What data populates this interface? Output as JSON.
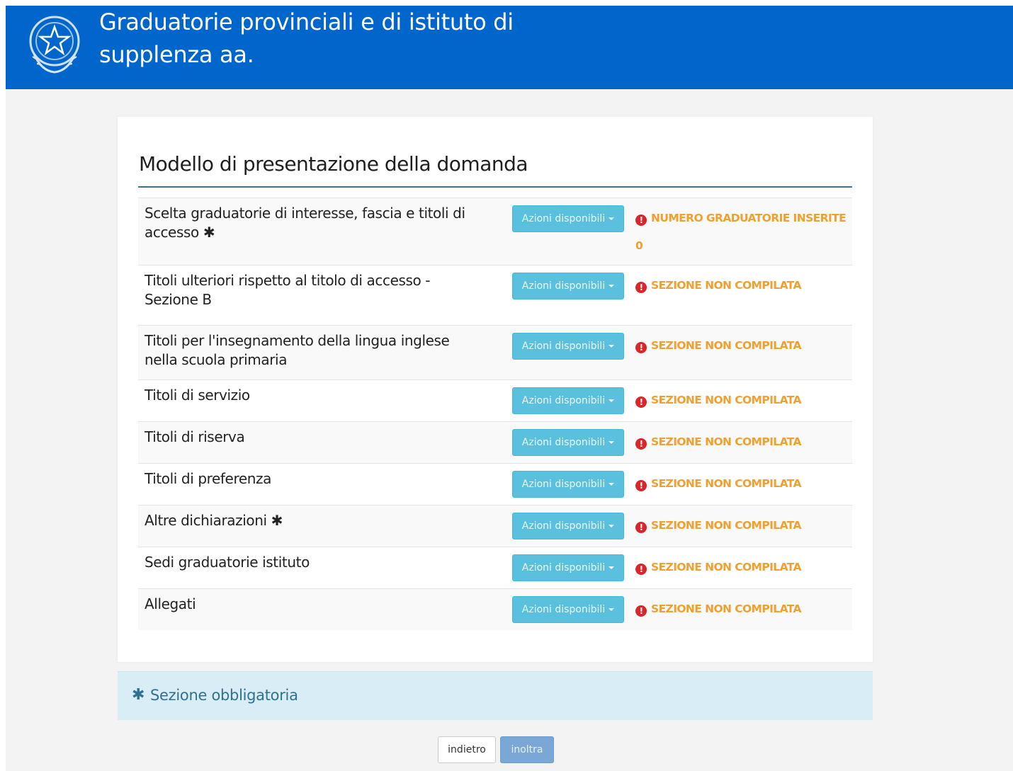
{
  "header": {
    "title": "Graduatorie provinciali e di istituto di supplenza aa."
  },
  "panel": {
    "title": "Modello di presentazione della domanda"
  },
  "colors": {
    "header_bg": "#0066cc",
    "action_button": "#5bc0de",
    "status_text": "#f0a030",
    "status_icon": "#d9262b",
    "note_bg": "#d9edf7"
  },
  "sections": [
    {
      "label": "Scelta graduatorie di interesse, fascia e titoli di accesso",
      "required": true,
      "action": "Azioni disponibili",
      "status": "NUMERO GRADUATORIE INSERITE",
      "status_extra": "0"
    },
    {
      "label": "Titoli ulteriori rispetto al titolo di accesso - Sezione B",
      "required": false,
      "action": "Azioni disponibili",
      "status": "SEZIONE NON COMPILATA"
    },
    {
      "label": "Titoli per l'insegnamento della lingua inglese nella scuola primaria",
      "required": false,
      "action": "Azioni disponibili",
      "status": "SEZIONE NON COMPILATA"
    },
    {
      "label": "Titoli di servizio",
      "required": false,
      "action": "Azioni disponibili",
      "status": "SEZIONE NON COMPILATA"
    },
    {
      "label": "Titoli di riserva",
      "required": false,
      "action": "Azioni disponibili",
      "status": "SEZIONE NON COMPILATA"
    },
    {
      "label": "Titoli di preferenza",
      "required": false,
      "action": "Azioni disponibili",
      "status": "SEZIONE NON COMPILATA"
    },
    {
      "label": "Altre dichiarazioni",
      "required": true,
      "action": "Azioni disponibili",
      "status": "SEZIONE NON COMPILATA"
    },
    {
      "label": "Sedi graduatorie istituto",
      "required": false,
      "action": "Azioni disponibili",
      "status": "SEZIONE NON COMPILATA"
    },
    {
      "label": "Allegati",
      "required": false,
      "action": "Azioni disponibili",
      "status": "SEZIONE NON COMPILATA"
    }
  ],
  "note": {
    "icon": "asterisk-icon",
    "text": "Sezione obbligatoria"
  },
  "footer": {
    "back_label": "indietro",
    "send_label": "inoltra"
  }
}
